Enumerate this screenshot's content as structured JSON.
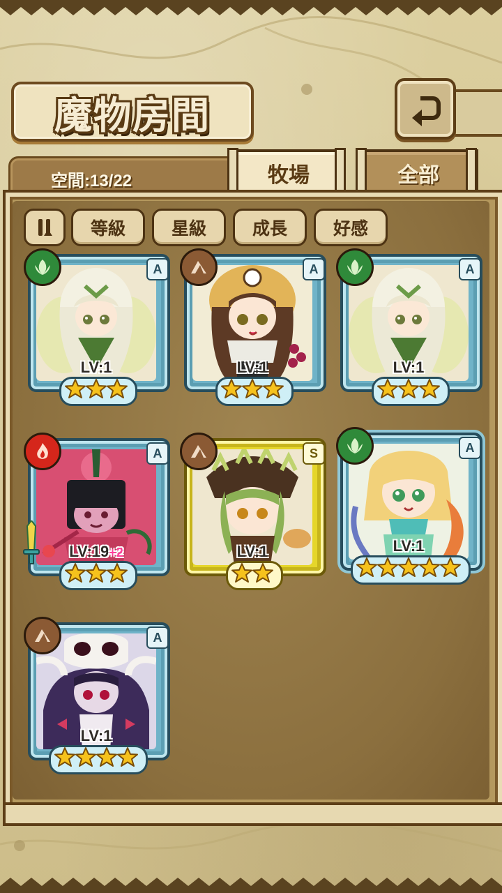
{
  "header": {
    "title": "魔物房間",
    "back_icon": "return-arrow-icon"
  },
  "storage": {
    "label": "空間:13/22"
  },
  "tabs": [
    {
      "label": "牧場",
      "active": true
    },
    {
      "label": "全部",
      "active": false
    }
  ],
  "sort": {
    "toggle_icon": "pause-sort-icon",
    "buttons": [
      "等級",
      "星級",
      "成長",
      "好感"
    ]
  },
  "monsters": [
    {
      "element": "wind",
      "rank": "A",
      "level": "LV:1",
      "bonus": "",
      "stars": 3,
      "frame": "blue",
      "art": "leaf-fairy"
    },
    {
      "element": "earth",
      "rank": "A",
      "level": "LV:1",
      "bonus": "",
      "stars": 3,
      "frame": "blue",
      "art": "owl-girl"
    },
    {
      "element": "wind",
      "rank": "A",
      "level": "LV:1",
      "bonus": "",
      "stars": 3,
      "frame": "blue",
      "art": "leaf-fairy"
    },
    {
      "element": "fire",
      "rank": "A",
      "level": "LV:19",
      "bonus": "+2",
      "stars": 3,
      "frame": "blue",
      "art": "flower-girl",
      "weapon": true
    },
    {
      "element": "earth",
      "rank": "S",
      "level": "LV:1",
      "bonus": "",
      "stars": 2,
      "frame": "gold",
      "art": "dragon-girl"
    },
    {
      "element": "wind",
      "rank": "A",
      "level": "LV:1",
      "bonus": "",
      "stars": 5,
      "frame": "ornate",
      "art": "mermaid-elf"
    },
    {
      "element": "earth",
      "rank": "A",
      "level": "LV:1",
      "bonus": "",
      "stars": 4,
      "frame": "blue",
      "art": "skull-witch"
    }
  ],
  "colors": {
    "background": "#d8c99c",
    "panel": "#8b6f3e",
    "frame_blue": "#6fb3c8",
    "frame_gold": "#e5d62a",
    "star": "#f6c21c",
    "wind": "#2f8a3a",
    "earth": "#8b5a34",
    "fire": "#d5261b"
  }
}
